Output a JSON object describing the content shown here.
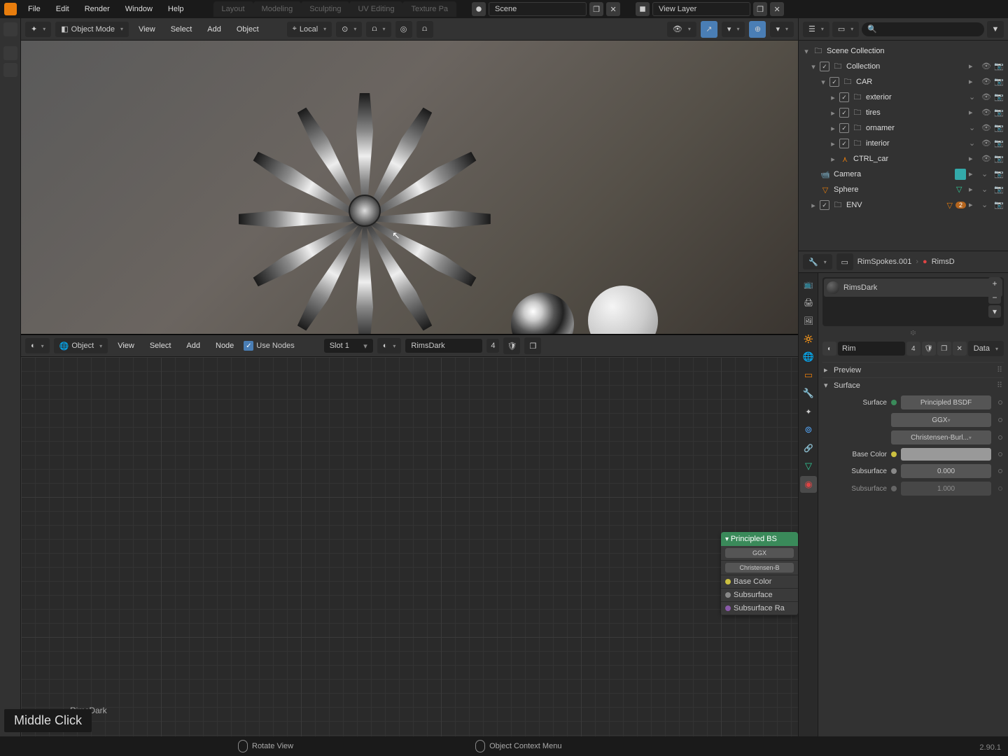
{
  "menubar": {
    "file": "File",
    "edit": "Edit",
    "render": "Render",
    "window": "Window",
    "help": "Help"
  },
  "workspaces": [
    "Layout",
    "Modeling",
    "Sculpting",
    "UV Editing",
    "Texture Pa"
  ],
  "scene": {
    "label": "Scene",
    "viewlayer": "View Layer"
  },
  "viewport_header": {
    "mode": "Object Mode",
    "view": "View",
    "select": "Select",
    "add": "Add",
    "object": "Object",
    "orientation": "Local"
  },
  "outliner": {
    "root": "Scene Collection",
    "items": [
      {
        "label": "Collection",
        "indent": 1,
        "icon": "collection",
        "check": true,
        "restrict": [
          "sel",
          "eye",
          "cam"
        ]
      },
      {
        "label": "CAR",
        "indent": 2,
        "icon": "collection",
        "check": true,
        "restrict": [
          "sel",
          "eye",
          "cam"
        ]
      },
      {
        "label": "exterior",
        "indent": 3,
        "icon": "collection",
        "check": true,
        "restrict": [
          "chev",
          "eye",
          "cam"
        ]
      },
      {
        "label": "tires",
        "indent": 3,
        "icon": "collection",
        "check": true,
        "restrict": [
          "sel",
          "eye",
          "cam"
        ]
      },
      {
        "label": "ornamer",
        "indent": 3,
        "icon": "collection",
        "check": true,
        "restrict": [
          "chev",
          "eye",
          "cam"
        ]
      },
      {
        "label": "interior",
        "indent": 3,
        "icon": "collection",
        "check": true,
        "restrict": [
          "chev",
          "eye",
          "cam"
        ]
      },
      {
        "label": "CTRL_car",
        "indent": 3,
        "icon": "armature",
        "check": false,
        "restrict": [
          "sel",
          "eye",
          "cam"
        ],
        "armature": true
      },
      {
        "label": "Camera",
        "indent": 2,
        "icon": "camera",
        "check": false,
        "restrict": [
          "sel",
          "chev",
          "cam"
        ],
        "extra": true
      },
      {
        "label": "Sphere",
        "indent": 2,
        "icon": "mesh",
        "check": false,
        "restrict": [
          "sel",
          "chev",
          "cam"
        ],
        "mesh": true
      },
      {
        "label": "ENV",
        "indent": 1,
        "icon": "collection",
        "check": true,
        "restrict": [
          "sel",
          "chev",
          "cam"
        ],
        "badge": "2"
      }
    ]
  },
  "node_header": {
    "mode": "Object",
    "view": "View",
    "select": "Select",
    "add": "Add",
    "node": "Node",
    "use_nodes": "Use Nodes",
    "slot": "Slot 1",
    "material": "RimsDark",
    "users": "4"
  },
  "node_canvas": {
    "label": "RimsDark",
    "node": {
      "title": "Principled BS",
      "dist": "GGX",
      "sss": "Christensen-B",
      "base_color": "Base Color",
      "subsurface": "Subsurface",
      "subsurface_ra": "Subsurface Ra"
    }
  },
  "properties": {
    "obj_breadcrumb": "RimSpokes.001",
    "mat_breadcrumb": "RimsD",
    "slot_name": "RimsDark",
    "mat_name": "Rim",
    "mat_users": "4",
    "link": "Data",
    "panels": {
      "preview": "Preview",
      "surface": "Surface"
    },
    "surface": {
      "label": "Surface",
      "shader": "Principled BSDF",
      "dist": "GGX",
      "sss_method": "Christensen-Burl...",
      "base_color": "Base Color",
      "subsurface": "Subsurface",
      "subsurface_val": "0.000",
      "subsurface2": "Subsurface",
      "subsurface2_val": "1.000"
    }
  },
  "status": {
    "hint": "Middle Click",
    "rotate": "Rotate View",
    "context": "Object Context Menu",
    "version": "2.90.1"
  }
}
